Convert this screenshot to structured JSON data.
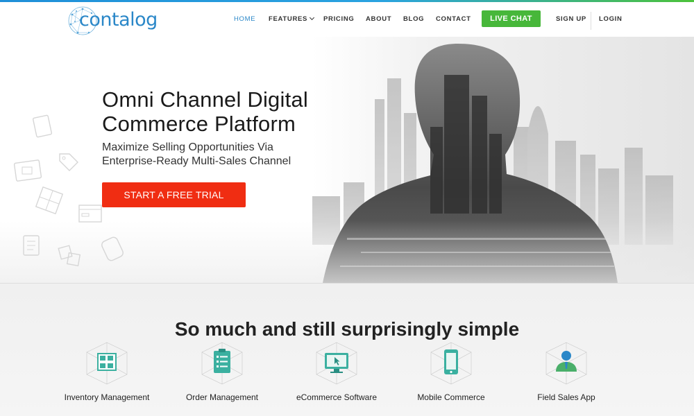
{
  "brand": {
    "logo_text": "contalog",
    "logo_icon": "network-globe-icon"
  },
  "nav": {
    "items": [
      {
        "label": "HOME",
        "active": true
      },
      {
        "label": "FEATURES",
        "has_dropdown": true
      },
      {
        "label": "PRICING"
      },
      {
        "label": "ABOUT"
      },
      {
        "label": "BLOG"
      },
      {
        "label": "CONTACT"
      }
    ],
    "live_chat": "LIVE CHAT",
    "sign_up": "SIGN UP",
    "login": "LOGIN"
  },
  "hero": {
    "title_line1": "Omni Channel Digital",
    "title_line2": "Commerce Platform",
    "subtitle_line1": "Maximize Selling Opportunities Via",
    "subtitle_line2": "Enterprise-Ready Multi-Sales Channel",
    "cta": "START A FREE TRIAL"
  },
  "features": {
    "title": "So much and still surprisingly simple",
    "items": [
      {
        "label": "Inventory Management",
        "icon": "warehouse-shelf-icon"
      },
      {
        "label": "Order Management",
        "icon": "clipboard-list-icon"
      },
      {
        "label": "eCommerce Software",
        "icon": "monitor-cursor-icon"
      },
      {
        "label": "Mobile Commerce",
        "icon": "smartphone-icon"
      },
      {
        "label": "Field Sales App",
        "icon": "salesperson-icon"
      }
    ]
  },
  "colors": {
    "brand_blue": "#2a87c8",
    "live_chat_green": "#47b73a",
    "cta_red": "#f02d12",
    "icon_teal": "#3bb0a0",
    "icon_green": "#4aaf6a"
  }
}
